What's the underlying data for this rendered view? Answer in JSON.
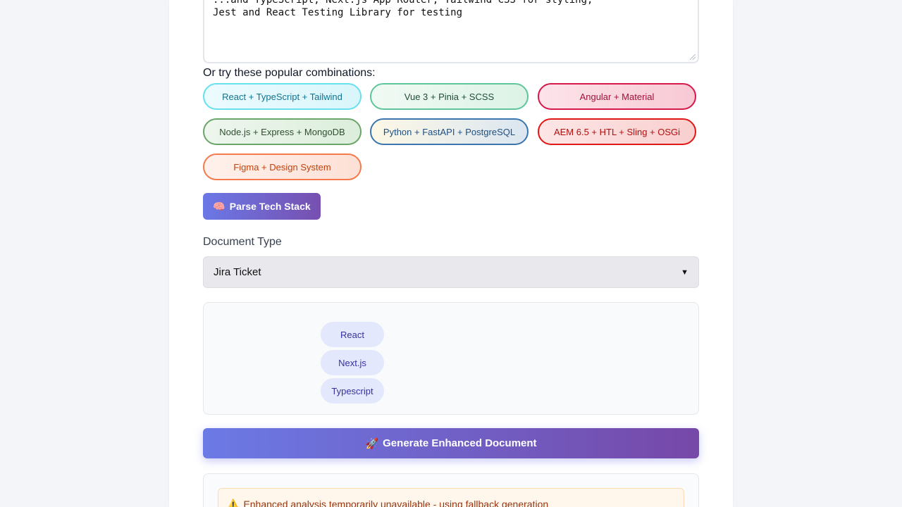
{
  "textarea": {
    "line1": "...and TypeScript, Next.js App Router, Tailwind CSS for styling,",
    "line2": "Jest and React Testing Library for testing"
  },
  "combos": {
    "label": "Or try these popular combinations:",
    "items": [
      "React + TypeScript + Tailwind",
      "Vue 3 + Pinia + SCSS",
      "Angular + Material",
      "Node.js + Express + MongoDB",
      "Python + FastAPI + PostgreSQL",
      "AEM 6.5 + HTL + Sling + OSGi",
      "Figma + Design System"
    ]
  },
  "parse_button": {
    "icon": "🧠",
    "label": "Parse Tech Stack"
  },
  "document_type": {
    "label": "Document Type",
    "selected": "Jira Ticket"
  },
  "tags": [
    "React",
    "Next.js",
    "Typescript"
  ],
  "generate_button": {
    "icon": "🚀",
    "label": "Generate Enhanced Document"
  },
  "warning": {
    "icon": "⚠️",
    "text": "Enhanced analysis temporarily unavailable - using fallback generation"
  }
}
